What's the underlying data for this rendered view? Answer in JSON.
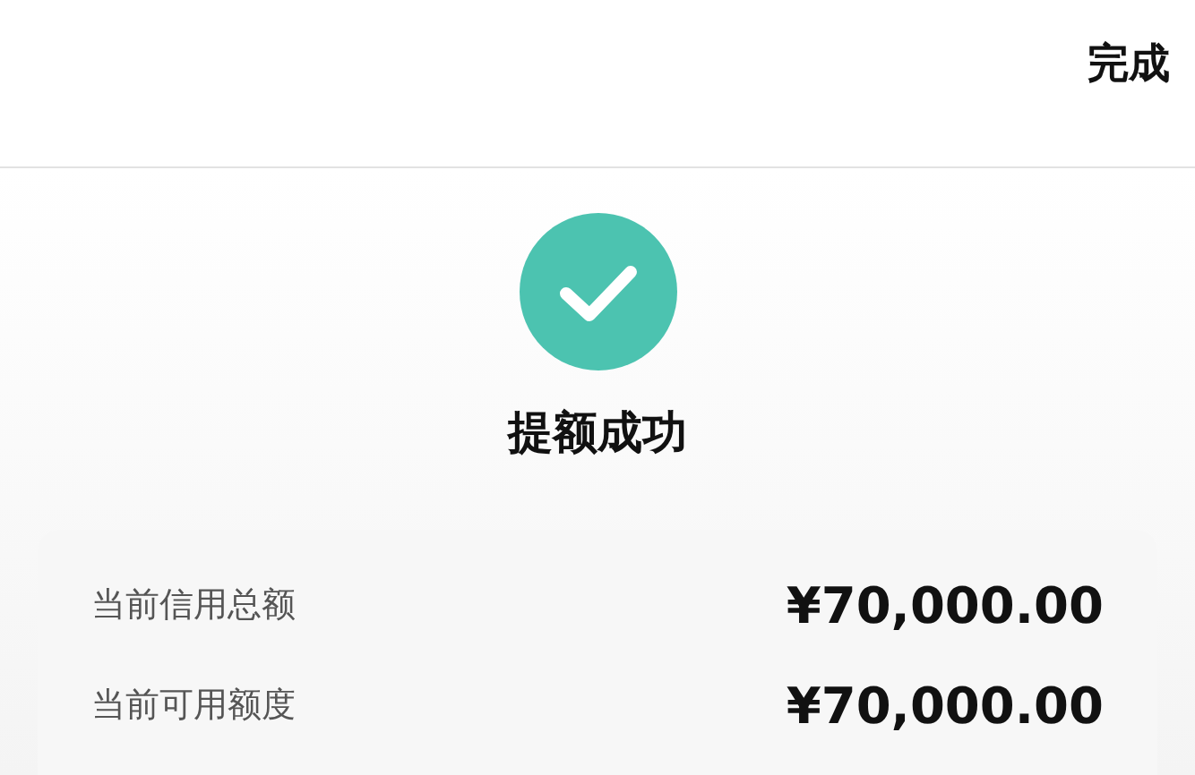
{
  "header": {
    "done_button": "完成"
  },
  "result": {
    "title": "提额成功"
  },
  "summary": {
    "rows": [
      {
        "label": "当前信用总额",
        "value": "¥70,000.00"
      },
      {
        "label": "当前可用额度",
        "value": "¥70,000.00"
      }
    ]
  }
}
